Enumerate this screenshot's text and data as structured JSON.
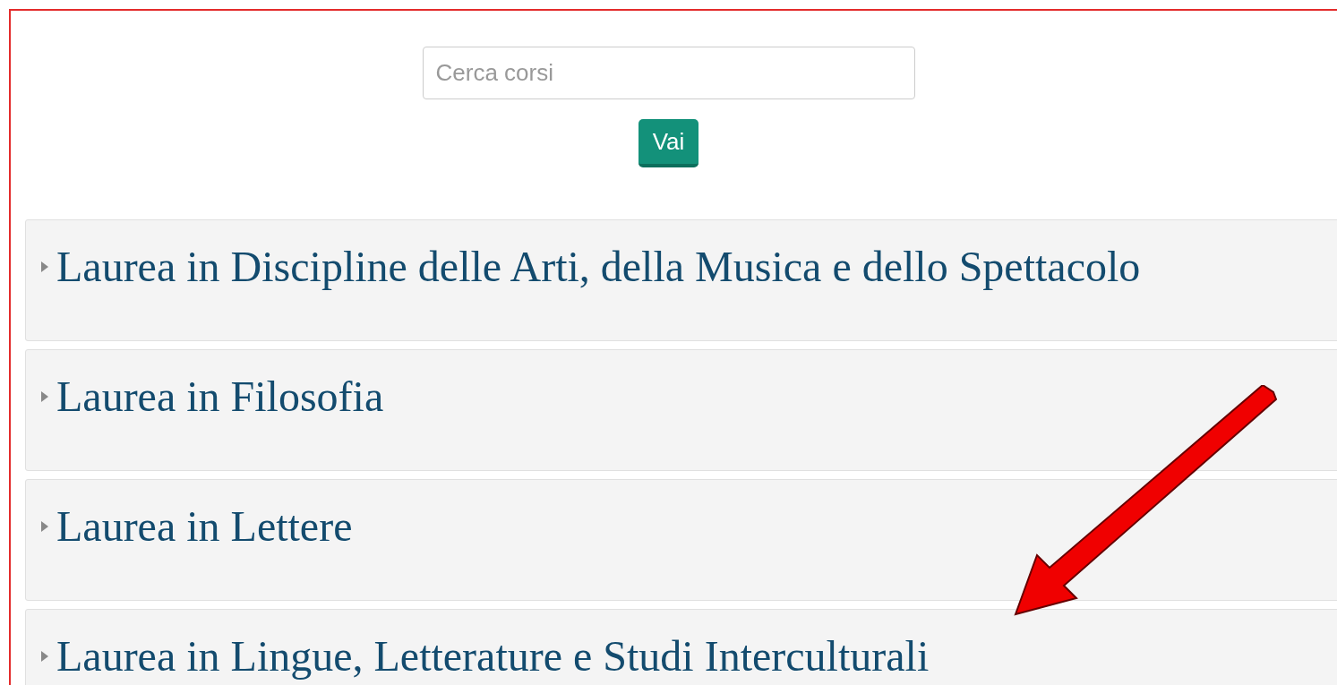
{
  "search": {
    "placeholder": "Cerca corsi"
  },
  "search_button": "Vai",
  "categories": [
    {
      "label": "Laurea in Discipline delle Arti, della Musica e dello Spettacolo",
      "expanded": false
    },
    {
      "label": "Laurea in Filosofia",
      "expanded": false
    },
    {
      "label": "Laurea in Lettere",
      "expanded": false
    },
    {
      "label": "Laurea in Lingue, Letterature e Studi Interculturali",
      "expanded": false
    }
  ]
}
